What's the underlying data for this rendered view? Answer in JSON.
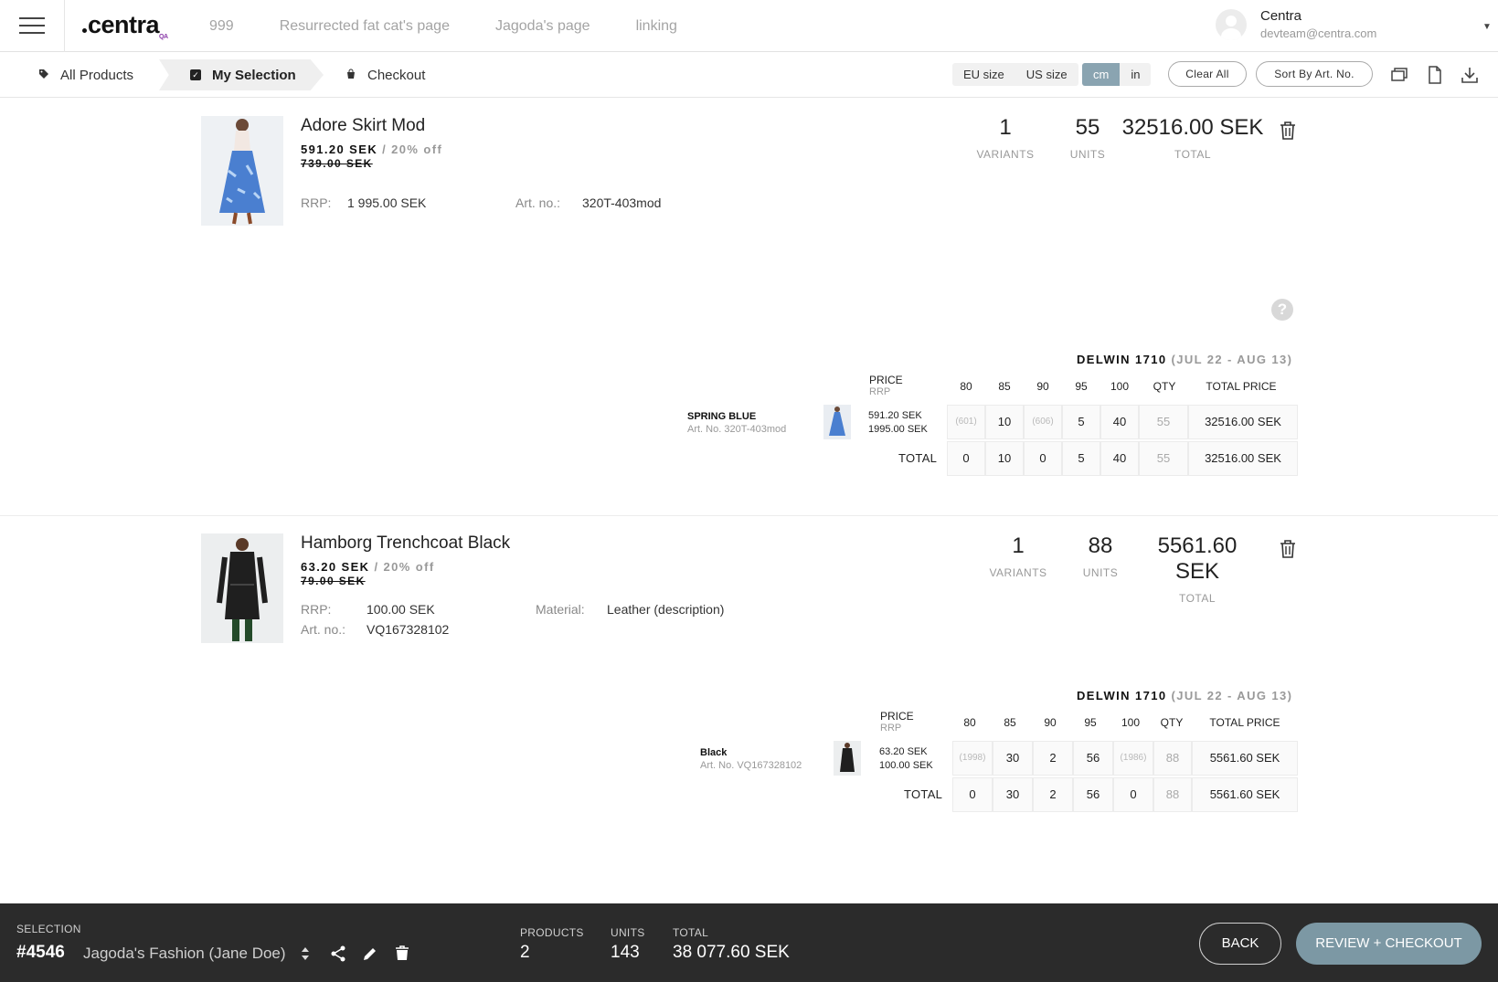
{
  "nav": {
    "logo": "centra",
    "logo_sub": "QA",
    "links": [
      "999",
      "Resurrected fat cat's page",
      "Jagoda's page",
      "linking"
    ],
    "user_name": "Centra",
    "user_email": "devteam@centra.com"
  },
  "subnav": {
    "all_products": "All Products",
    "my_selection": "My Selection",
    "checkout": "Checkout",
    "size_options": [
      "EU size",
      "US size"
    ],
    "unit_options": [
      "cm",
      "in"
    ],
    "active_unit": "cm",
    "clear_all": "Clear All",
    "sort": "Sort By Art. No."
  },
  "products": [
    {
      "title": "Adore Skirt Mod",
      "price": "591.20 SEK",
      "discount": "/ 20% off",
      "was_price": "739.00 SEK",
      "rrp_label": "RRP:",
      "rrp": "1 995.00 SEK",
      "art_label": "Art. no.:",
      "art_no": "320T-403mod",
      "variants": "1",
      "units": "55",
      "total": "32516.00 SEK",
      "variants_label": "VARIANTS",
      "units_label": "UNITS",
      "total_label": "TOTAL",
      "delivery_name": "DELWIN 1710",
      "delivery_dates": "(JUL 22 - AUG 13)",
      "price_head": "PRICE",
      "rrp_head": "RRP",
      "sizes": [
        "80",
        "85",
        "90",
        "95",
        "100"
      ],
      "qty_head": "QTY",
      "total_price_head": "TOTAL PRICE",
      "variant_name": "SPRING BLUE",
      "variant_art": "Art. No. 320T-403mod",
      "variant_price": "591.20 SEK",
      "variant_rrp": "1995.00 SEK",
      "row": [
        "(601)",
        "10",
        "(606)",
        "5",
        "40"
      ],
      "row_qty": "55",
      "row_total": "32516.00 SEK",
      "total_row_label": "TOTAL",
      "totals": [
        "0",
        "10",
        "0",
        "5",
        "40"
      ],
      "totals_qty": "55",
      "totals_total": "32516.00 SEK"
    },
    {
      "title": "Hamborg Trenchcoat Black",
      "price": "63.20 SEK",
      "discount": "/ 20% off",
      "was_price": "79.00 SEK",
      "rrp_label": "RRP:",
      "rrp": "100.00 SEK",
      "art_label": "Art. no.:",
      "art_no": "VQ167328102",
      "material_label": "Material:",
      "material": "Leather (description)",
      "variants": "1",
      "units": "88",
      "total": "5561.60 SEK",
      "variants_label": "VARIANTS",
      "units_label": "UNITS",
      "total_label": "TOTAL",
      "delivery_name": "DELWIN 1710",
      "delivery_dates": "(JUL 22 - AUG 13)",
      "price_head": "PRICE",
      "rrp_head": "RRP",
      "sizes": [
        "80",
        "85",
        "90",
        "95",
        "100"
      ],
      "qty_head": "QTY",
      "total_price_head": "TOTAL PRICE",
      "variant_name": "Black",
      "variant_art": "Art. No. VQ167328102",
      "variant_price": "63.20 SEK",
      "variant_rrp": "100.00 SEK",
      "row": [
        "(1998)",
        "30",
        "2",
        "56",
        "(1986)"
      ],
      "row_qty": "88",
      "row_total": "5561.60 SEK",
      "total_row_label": "TOTAL",
      "totals": [
        "0",
        "30",
        "2",
        "56",
        "0"
      ],
      "totals_qty": "88",
      "totals_total": "5561.60 SEK"
    }
  ],
  "footer": {
    "selection_label": "SELECTION",
    "selection_number": "#4546",
    "selection_name": "Jagoda's Fashion (Jane Doe)",
    "products_label": "PRODUCTS",
    "products": "2",
    "units_label": "UNITS",
    "units": "143",
    "total_label": "TOTAL",
    "total": "38 077.60 SEK",
    "back": "BACK",
    "review": "REVIEW + CHECKOUT"
  },
  "colors": {
    "accent": "#8aa4b1",
    "review_button": "#7c98a4",
    "footer_bg": "#2b2b2b"
  }
}
